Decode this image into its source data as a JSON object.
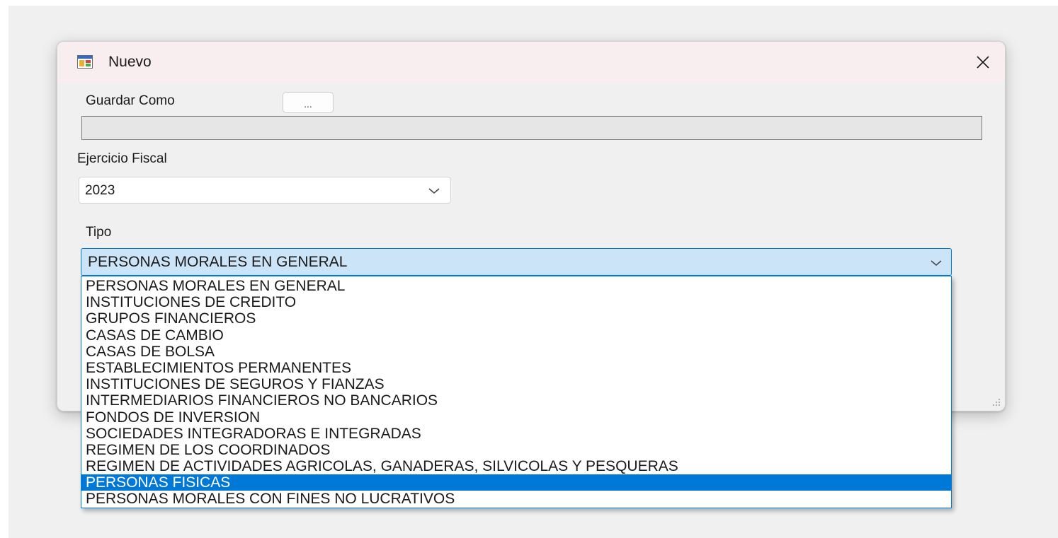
{
  "window": {
    "title": "Nuevo",
    "icon": "windows-form-icon",
    "close_icon": "close-icon"
  },
  "form": {
    "guardar_label": "Guardar Como",
    "browse_label": "...",
    "path_value": "",
    "ejercicio_label": "Ejercicio Fiscal",
    "ejercicio_value": "2023",
    "tipo_label": "Tipo",
    "tipo_value": "PERSONAS MORALES EN GENERAL"
  },
  "dropdown": {
    "selected_index": 12,
    "options": [
      "PERSONAS MORALES EN GENERAL",
      "INSTITUCIONES DE CREDITO",
      "GRUPOS FINANCIEROS",
      "CASAS DE CAMBIO",
      "CASAS DE BOLSA",
      "ESTABLECIMIENTOS PERMANENTES",
      "INSTITUCIONES DE SEGUROS Y FIANZAS",
      "INTERMEDIARIOS FINANCIEROS NO BANCARIOS",
      "FONDOS DE INVERSION",
      "SOCIEDADES INTEGRADORAS E INTEGRADAS",
      "REGIMEN DE LOS COORDINADOS",
      "REGIMEN DE ACTIVIDADES AGRICOLAS, GANADERAS, SILVICOLAS Y PESQUERAS",
      "PERSONAS FISICAS",
      "PERSONAS MORALES CON FINES NO LUCRATIVOS"
    ]
  },
  "colors": {
    "accent": "#0078d7",
    "selected_bg": "#cce4f7",
    "titlebar_bg": "#f9eeef",
    "window_bg": "#f0f0f0"
  }
}
